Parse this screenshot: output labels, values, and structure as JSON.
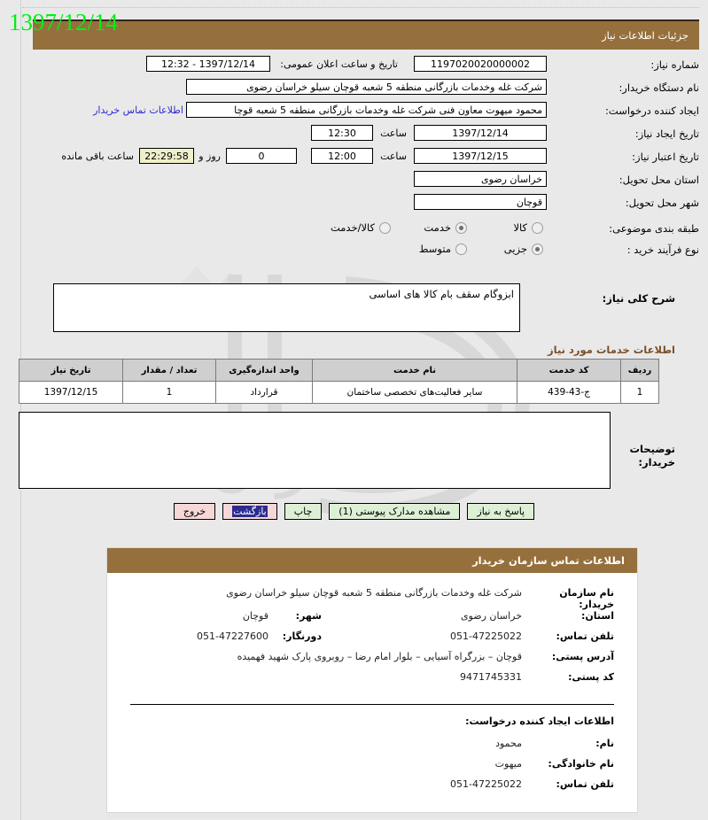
{
  "overlay": {
    "date_stamp": "1397/12/14"
  },
  "header": {
    "title": "جزئیات اطلاعات نیاز"
  },
  "form": {
    "need_number": {
      "label": "شماره نیاز:",
      "value": "1197020020000002"
    },
    "public_announce": {
      "label": "تاریخ و ساعت اعلان عمومی:",
      "value": "1397/12/14 - 12:32"
    },
    "buyer_org": {
      "label": "نام دستگاه خریدار:",
      "value": "شرکت غله وخدمات بازرگانی منطقه 5 شعبه قوچان سیلو خراسان رضوی"
    },
    "requester": {
      "label": "ایجاد کننده درخواست:",
      "value": "محمود میهوت معاون فنی شرکت غله وخدمات بازرگانی منطقه 5 شعبه قوچا",
      "link": "اطلاعات تماس خریدار"
    },
    "create_date": {
      "label": "تاریخ ایجاد نیاز:",
      "value": "1397/12/14",
      "time_label": "ساعت",
      "time": "12:30"
    },
    "valid_date": {
      "label": "تاریخ اعتبار نیاز:",
      "value": "1397/12/15",
      "time_label": "ساعت",
      "time": "12:00"
    },
    "remaining": {
      "days": "0",
      "days_label": "روز و",
      "timer": "22:29:58",
      "suffix_label": "ساعت باقی مانده"
    },
    "province": {
      "label": "استان محل تحویل:",
      "value": "خراسان رضوی"
    },
    "city": {
      "label": "شهر محل تحویل:",
      "value": "قوچان"
    },
    "category": {
      "label": "طبقه بندی موضوعی:",
      "options": [
        {
          "label": "کالا",
          "checked": false
        },
        {
          "label": "خدمت",
          "checked": true
        },
        {
          "label": "کالا/خدمت",
          "checked": false
        }
      ]
    },
    "process_type": {
      "label": "نوع فرآیند خرید :",
      "options": [
        {
          "label": "جزیی",
          "checked": true
        },
        {
          "label": "متوسط",
          "checked": false
        }
      ]
    },
    "general_desc": {
      "label": "شرح کلی نیاز:",
      "value": "ابزوگام سقف بام کالا های اساسی"
    },
    "buyer_notes": {
      "label_line1": "توضیحات",
      "label_line2": "خریدار:",
      "value": ""
    }
  },
  "items_section": {
    "title": "اطلاعات خدمات مورد نیاز",
    "columns": [
      "ردیف",
      "کد خدمت",
      "نام خدمت",
      "واحد اندازه‌گیری",
      "تعداد / مقدار",
      "تاریخ نیاز"
    ],
    "rows": [
      [
        "1",
        "ج-43-439",
        "سایر فعالیت‌های تخصصی ساختمان",
        "قرارداد",
        "1",
        "1397/12/15"
      ]
    ]
  },
  "buttons": [
    {
      "label": "پاسخ به نیاز",
      "style": "green",
      "selected": false
    },
    {
      "label": "مشاهده مدارک پیوستی (1)",
      "style": "green",
      "selected": false
    },
    {
      "label": "چاپ",
      "style": "green",
      "selected": false
    },
    {
      "label": "بازگشت",
      "style": "red",
      "selected": true
    },
    {
      "label": "خروج",
      "style": "red",
      "selected": false
    }
  ],
  "contact": {
    "title": "اطلاعات تماس سازمان خریدار",
    "org_name": {
      "label": "نام سازمان خریدار:",
      "value": "شرکت غله وخدمات بازرگانی منطقه 5 شعبه قوچان سیلو خراسان رضوی"
    },
    "province": {
      "label": "استان:",
      "value": "خراسان رضوی"
    },
    "city": {
      "label": "شهر:",
      "value": "قوچان"
    },
    "phone": {
      "label": "تلفن تماس:",
      "value": "051-47225022"
    },
    "fax": {
      "label": "دورنگار:",
      "value": "051-47227600"
    },
    "address": {
      "label": "آدرس پستی:",
      "value": "قوچان – بزرگراه آسیایی – بلوار امام رضا – روبروی پارک شهید فهمیده"
    },
    "postal_code": {
      "label": "کد پستی:",
      "value": "9471745331"
    },
    "requester_section": {
      "title": "اطلاعات ایجاد کننده درخواست:",
      "first_name": {
        "label": "نام:",
        "value": "محمود"
      },
      "last_name": {
        "label": "نام خانوادگی:",
        "value": "میهوت"
      },
      "phone": {
        "label": "تلفن تماس:",
        "value": "051-47225022"
      }
    }
  },
  "colors": {
    "brand_brown": "#96703c",
    "header_text": "#ffffff",
    "link_blue": "#2b2bcf",
    "timer_bg": "#efefcc",
    "green_btn": "#ddf0d6",
    "red_btn": "#f6d7d7",
    "overlay_green": "#00f015",
    "section_title": "#7b4f26"
  }
}
